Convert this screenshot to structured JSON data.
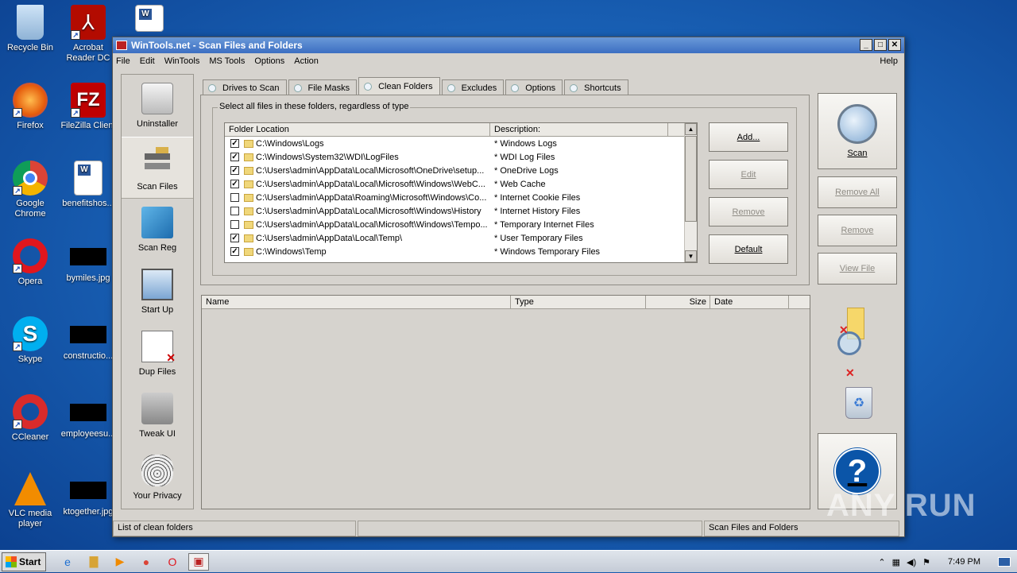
{
  "desktop": {
    "icons": [
      {
        "label": "Recycle Bin"
      },
      {
        "label": "Acrobat Reader DC"
      },
      {
        "label": "Firefox"
      },
      {
        "label": "FileZilla Client"
      },
      {
        "label": "Google Chrome"
      },
      {
        "label": "benefitshos..."
      },
      {
        "label": "Opera"
      },
      {
        "label": "bymiles.jpg"
      },
      {
        "label": "Skype"
      },
      {
        "label": "constructio..."
      },
      {
        "label": "CCleaner"
      },
      {
        "label": "employeesu..."
      },
      {
        "label": "VLC media player"
      },
      {
        "label": "ktogether.jpg"
      }
    ]
  },
  "window": {
    "title": "WinTools.net - Scan Files and Folders",
    "menu": [
      "File",
      "Edit",
      "WinTools",
      "MS Tools",
      "Options",
      "Action"
    ],
    "help": "Help",
    "sidebar": [
      {
        "label": "Uninstaller"
      },
      {
        "label": "Scan Files"
      },
      {
        "label": "Scan Reg"
      },
      {
        "label": "Start Up"
      },
      {
        "label": "Dup Files"
      },
      {
        "label": "Tweak UI"
      },
      {
        "label": "Your Privacy"
      }
    ],
    "tabs": [
      {
        "label": "Drives to Scan"
      },
      {
        "label": "File Masks"
      },
      {
        "label": "Clean Folders"
      },
      {
        "label": "Excludes"
      },
      {
        "label": "Options"
      },
      {
        "label": "Shortcuts"
      }
    ],
    "group_label": "Select all files in these folders, regardless of type",
    "list_headers": {
      "folder": "Folder Location",
      "description": "Description:"
    },
    "folders": [
      {
        "checked": true,
        "path": "C:\\Windows\\Logs",
        "desc": "* Windows Logs"
      },
      {
        "checked": true,
        "path": "C:\\Windows\\System32\\WDI\\LogFiles",
        "desc": "* WDI Log Files"
      },
      {
        "checked": true,
        "path": "C:\\Users\\admin\\AppData\\Local\\Microsoft\\OneDrive\\setup...",
        "desc": "* OneDrive Logs"
      },
      {
        "checked": true,
        "path": "C:\\Users\\admin\\AppData\\Local\\Microsoft\\Windows\\WebC...",
        "desc": "* Web Cache"
      },
      {
        "checked": false,
        "path": "C:\\Users\\admin\\AppData\\Roaming\\Microsoft\\Windows\\Co...",
        "desc": "* Internet Cookie Files"
      },
      {
        "checked": false,
        "path": "C:\\Users\\admin\\AppData\\Local\\Microsoft\\Windows\\History",
        "desc": "* Internet History Files"
      },
      {
        "checked": false,
        "path": "C:\\Users\\admin\\AppData\\Local\\Microsoft\\Windows\\Tempo...",
        "desc": "* Temporary Internet Files"
      },
      {
        "checked": true,
        "path": "C:\\Users\\admin\\AppData\\Local\\Temp\\",
        "desc": "* User Temporary Files"
      },
      {
        "checked": true,
        "path": "C:\\Windows\\Temp",
        "desc": "* Windows Temporary Files"
      }
    ],
    "group_buttons": {
      "add": "Add...",
      "edit": "Edit",
      "remove": "Remove",
      "default": "Default"
    },
    "result_headers": {
      "name": "Name",
      "type": "Type",
      "size": "Size",
      "date": "Date"
    },
    "right_buttons": {
      "scan": "Scan",
      "remove_all": "Remove All",
      "remove": "Remove",
      "view_file": "View File",
      "help": "?"
    },
    "status": {
      "left": "List of clean folders",
      "middle": "",
      "right": "Scan Files and Folders"
    }
  },
  "taskbar": {
    "start": "Start",
    "time": "7:49 PM"
  },
  "watermark": "ANY RUN"
}
